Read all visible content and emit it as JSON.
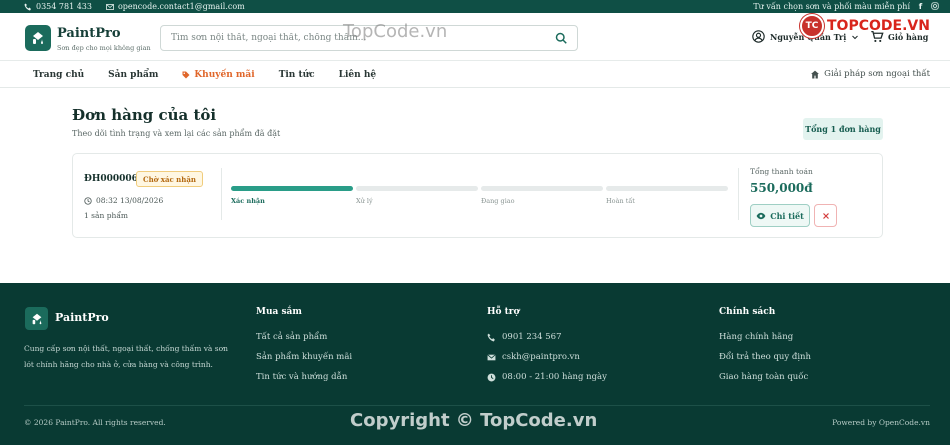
{
  "topbar": {
    "phone": "0354 781 433",
    "email": "opencode.contact1@gmail.com",
    "advice": "Tư vấn chọn sơn và phối màu miễn phí"
  },
  "header": {
    "brand": "PaintPro",
    "tagline": "Sơn đẹp cho mọi không gian",
    "search_placeholder": "Tìm sơn nội thất, ngoại thất, chống thấm...",
    "user_name": "Nguyễn Quản Trị",
    "cart_label": "Giỏ hàng"
  },
  "nav": {
    "items": [
      "Trang chủ",
      "Sản phẩm",
      "Khuyến mãi",
      "Tin tức",
      "Liên hệ"
    ],
    "solution": "Giải pháp sơn ngoại thất"
  },
  "main": {
    "title": "Đơn hàng của tôi",
    "subtitle": "Theo dõi tình trạng và xem lại các sản phẩm đã đặt",
    "total_badge": "Tổng 1 đơn hàng",
    "order": {
      "id": "ĐH000006",
      "status": "Chờ xác nhận",
      "time": "08:32 13/08/2026",
      "count": "1 sản phẩm",
      "steps": [
        "Xác nhận",
        "Xử lý",
        "Đang giao",
        "Hoàn tất"
      ],
      "active_step": 1,
      "total_label": "Tổng thanh toán",
      "total_value": "550,000đ",
      "detail_label": "Chi tiết"
    }
  },
  "footer": {
    "brand": "PaintPro",
    "desc": "Cung cấp sơn nội thất, ngoại thất, chống thấm và sơn lót chính hãng cho nhà ở, cửa hàng và công trình.",
    "col1": {
      "title": "Mua sắm",
      "items": [
        "Tất cả sản phẩm",
        "Sản phẩm khuyến mãi",
        "Tin tức và hướng dẫn"
      ]
    },
    "col2": {
      "title": "Hỗ trợ",
      "items": [
        "0901 234 567",
        "cskh@paintpro.vn",
        "08:00 - 21:00 hàng ngày"
      ]
    },
    "col3": {
      "title": "Chính sách",
      "items": [
        "Hàng chính hãng",
        "Đổi trả theo quy định",
        "Giao hàng toàn quốc"
      ]
    },
    "copyright": "© 2026 PaintPro. All rights reserved.",
    "powered": "Powered by OpenCode.vn"
  },
  "watermark": {
    "top": "TopCode.vn",
    "bottom": "Copyright © TopCode.vn",
    "badge_text": "TOPCODE.VN"
  },
  "colors": {
    "primary": "#1b6b5c",
    "topbar": "#0f4f45",
    "footer": "#093a33",
    "promo": "#e0662a",
    "danger": "#d33a3a"
  }
}
